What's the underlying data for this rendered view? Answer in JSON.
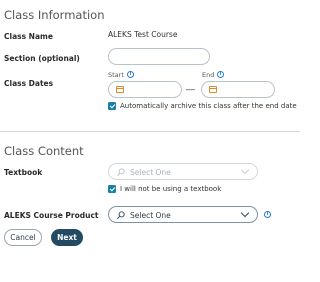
{
  "class_information": {
    "heading": "Class Information",
    "class_name_label": "Class Name",
    "class_name_value": "ALEKS Test Course",
    "section_label": "Section (optional)",
    "section_value": "",
    "class_dates_label": "Class Dates",
    "start_label": "Start",
    "end_label": "End",
    "date_separator": "—",
    "start_value": "",
    "end_value": "",
    "archive_checkbox_label": "Automatically archive this class after the end date",
    "archive_checked": true
  },
  "class_content": {
    "heading": "Class Content",
    "textbook_label": "Textbook",
    "textbook_placeholder": "Select One",
    "no_textbook_label": "I will not be using a textbook",
    "no_textbook_checked": true,
    "product_label": "ALEKS Course Product",
    "product_placeholder": "Select One"
  },
  "actions": {
    "cancel_label": "Cancel",
    "next_label": "Next"
  },
  "colors": {
    "accent_dark": "#234a63",
    "checkbox": "#1a7fa6",
    "info": "#2a7ccf",
    "calendar": "#d98e2c"
  }
}
